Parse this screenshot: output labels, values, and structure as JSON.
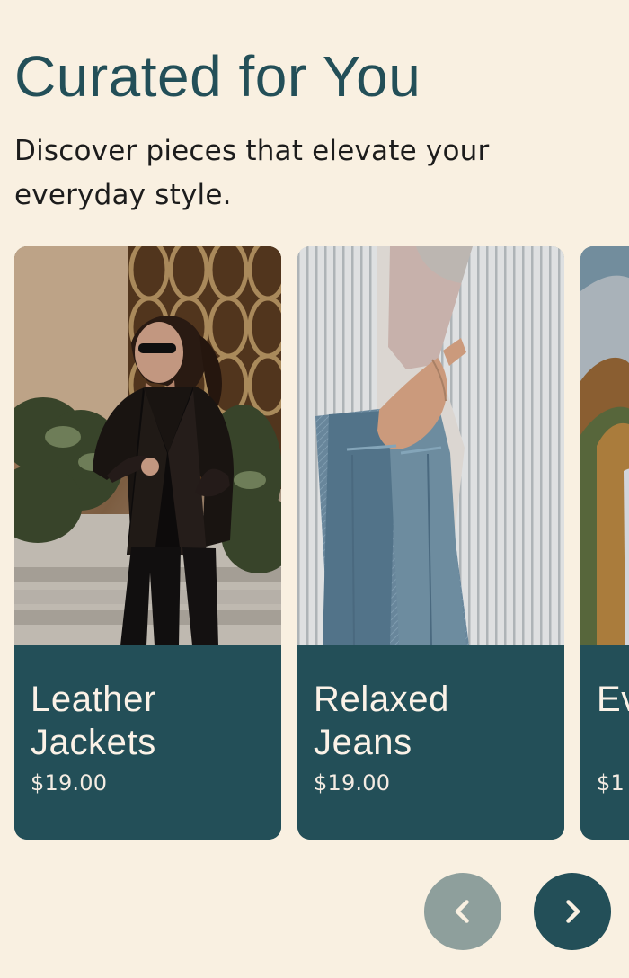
{
  "section": {
    "title": "Curated for You",
    "subtitle": "Discover pieces that elevate your everyday style."
  },
  "carousel": {
    "cards": [
      {
        "title": "Leather Jackets",
        "price": "$19.00",
        "image_alt": "Woman wearing a black leather jacket"
      },
      {
        "title": "Relaxed Jeans",
        "price": "$19.00",
        "image_alt": "Relaxed blue jeans with striped shirt"
      },
      {
        "title": "Ev",
        "price": "$1",
        "image_alt": "Partially visible outdoor product image"
      }
    ],
    "navigation": {
      "previous_icon": "chevron-left-icon",
      "next_icon": "chevron-right-icon"
    }
  },
  "colors": {
    "background": "#f9f0e1",
    "accent": "#234f58",
    "disabled_button": "#8e9f9c",
    "card_text": "#fbf2e7"
  }
}
